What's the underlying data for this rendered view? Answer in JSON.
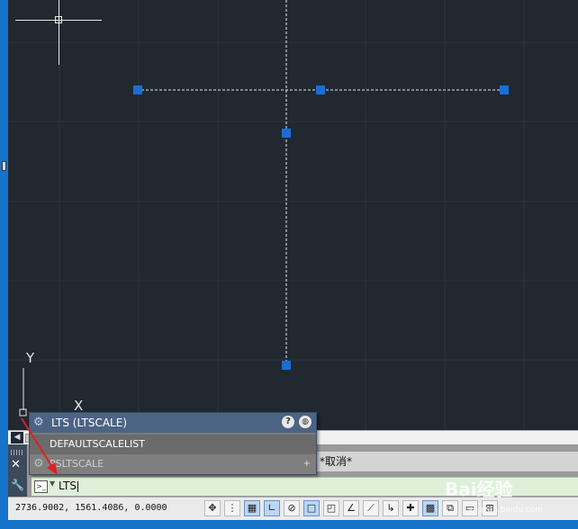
{
  "ucs": {
    "y_label": "Y",
    "x_label": "X"
  },
  "autocomplete": {
    "header": "LTS (LTSCALE)",
    "items": [
      "DEFAULTSCALELIST",
      "PSLTSCALE"
    ],
    "help_glyph": "?",
    "expand_glyph": "+"
  },
  "command_line": {
    "history_text": "*取消*",
    "input_value": "LTS",
    "prompt_glyph": ">_"
  },
  "status_bar": {
    "coordinates": "2736.9002, 1561.4086, 0.0000"
  },
  "watermark": {
    "text": "Bai经验",
    "sub": "jingyan.baidu.com"
  },
  "colors": {
    "canvas": "#212830",
    "grip": "#1a6fd6",
    "selected_line": "#e6e6e6",
    "palette_header": "#4c6384",
    "command_input": "#dff0d9",
    "annotation_arrow": "#e02020"
  }
}
